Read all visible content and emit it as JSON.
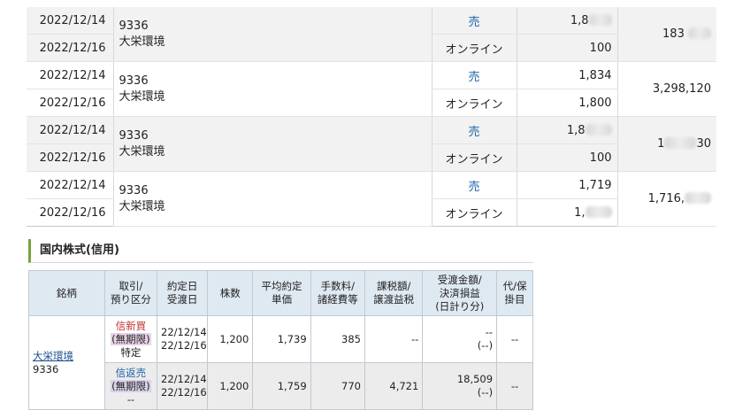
{
  "trades": [
    {
      "date1": "2022/12/14",
      "date2": "2022/12/16",
      "code": "9336",
      "name": "大栄環境",
      "side": "売",
      "type": "オンライン",
      "price": "1,8",
      "qty": "100",
      "amount": "183",
      "blur_price": true,
      "blur_amount": true
    },
    {
      "date1": "2022/12/14",
      "date2": "2022/12/16",
      "code": "9336",
      "name": "大栄環境",
      "side": "売",
      "type": "オンライン",
      "price": "1,834",
      "qty": "1,800",
      "amount": "3,298,120",
      "blur_price": false,
      "blur_amount": false
    },
    {
      "date1": "2022/12/14",
      "date2": "2022/12/16",
      "code": "9336",
      "name": "大栄環境",
      "side": "売",
      "type": "オンライン",
      "price": "1,8",
      "qty": "100",
      "amount": "1",
      "amount_tail": "30",
      "blur_price": true,
      "blur_amount": true
    },
    {
      "date1": "2022/12/14",
      "date2": "2022/12/16",
      "code": "9336",
      "name": "大栄環境",
      "side": "売",
      "type": "オンライン",
      "price": "1,719",
      "qty": "1,",
      "amount": "1,716,",
      "blur_price": false,
      "blur_qty": true,
      "blur_amount": true
    }
  ],
  "margin": {
    "heading": "国内株式(信用)",
    "headers": {
      "col1": "銘柄",
      "col2a": "取引/",
      "col2b": "預り区分",
      "col3a": "約定日",
      "col3b": "受渡日",
      "col4": "株数",
      "col5a": "平均約定",
      "col5b": "単価",
      "col6a": "手数料/",
      "col6b": "諸経費等",
      "col7a": "課税額/",
      "col7b": "譲渡益税",
      "col8a": "受渡金額/",
      "col8b": "決済損益",
      "col8c": "(日計り分)",
      "col9a": "代/保",
      "col9b": "掛目"
    },
    "stock_name": "大栄環境",
    "stock_code": "9336",
    "rows": [
      {
        "type1": "信新買",
        "type2": "(無期限)",
        "type3": "特定",
        "date1": "22/12/14",
        "date2": "22/12/16",
        "qty": "1,200",
        "price": "1,739",
        "fee": "385",
        "tax": "--",
        "settle1": "--",
        "settle2": "(--)",
        "ratio": "--"
      },
      {
        "type1": "信返売",
        "type2": "(無期限)",
        "type3": "--",
        "date1": "22/12/14",
        "date2": "22/12/16",
        "qty": "1,200",
        "price": "1,759",
        "fee": "770",
        "tax": "4,721",
        "settle1": "18,509",
        "settle2": "(--)",
        "ratio": "--"
      }
    ]
  }
}
